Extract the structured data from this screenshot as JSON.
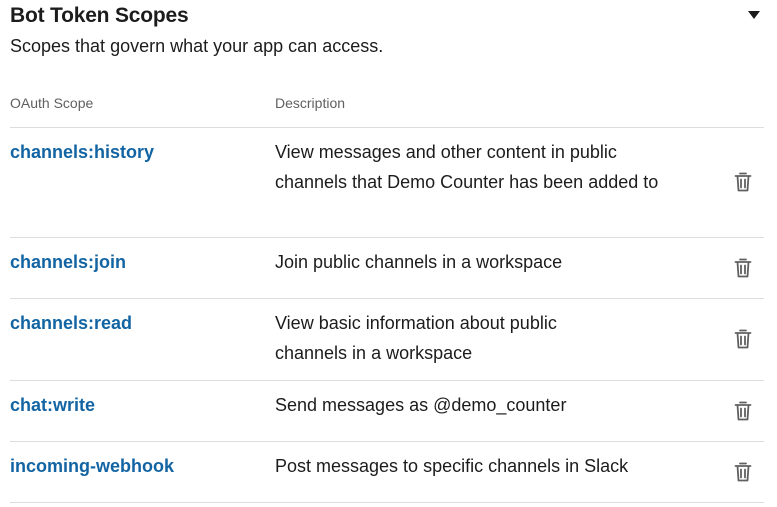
{
  "section": {
    "title": "Bot Token Scopes",
    "subtitle": "Scopes that govern what your app can access.",
    "collapse_icon": "caret-down-icon"
  },
  "table": {
    "headers": {
      "scope": "OAuth Scope",
      "description": "Description"
    },
    "rows": [
      {
        "scope": "channels:history",
        "description": "View messages and other content in public channels that Demo Counter has been added to",
        "action_icon": "trash-icon"
      },
      {
        "scope": "channels:join",
        "description": "Join public channels in a workspace",
        "action_icon": "trash-icon"
      },
      {
        "scope": "channels:read",
        "description": "View basic information about public channels in a workspace",
        "action_icon": "trash-icon"
      },
      {
        "scope": "chat:write",
        "description": "Send messages as @demo_counter",
        "action_icon": "trash-icon"
      },
      {
        "scope": "incoming-webhook",
        "description": "Post messages to specific channels in Slack",
        "action_icon": "trash-icon"
      }
    ]
  },
  "colors": {
    "link": "#1264a3",
    "text": "#1d1c1d",
    "muted": "#616061",
    "divider": "#dddddd"
  }
}
